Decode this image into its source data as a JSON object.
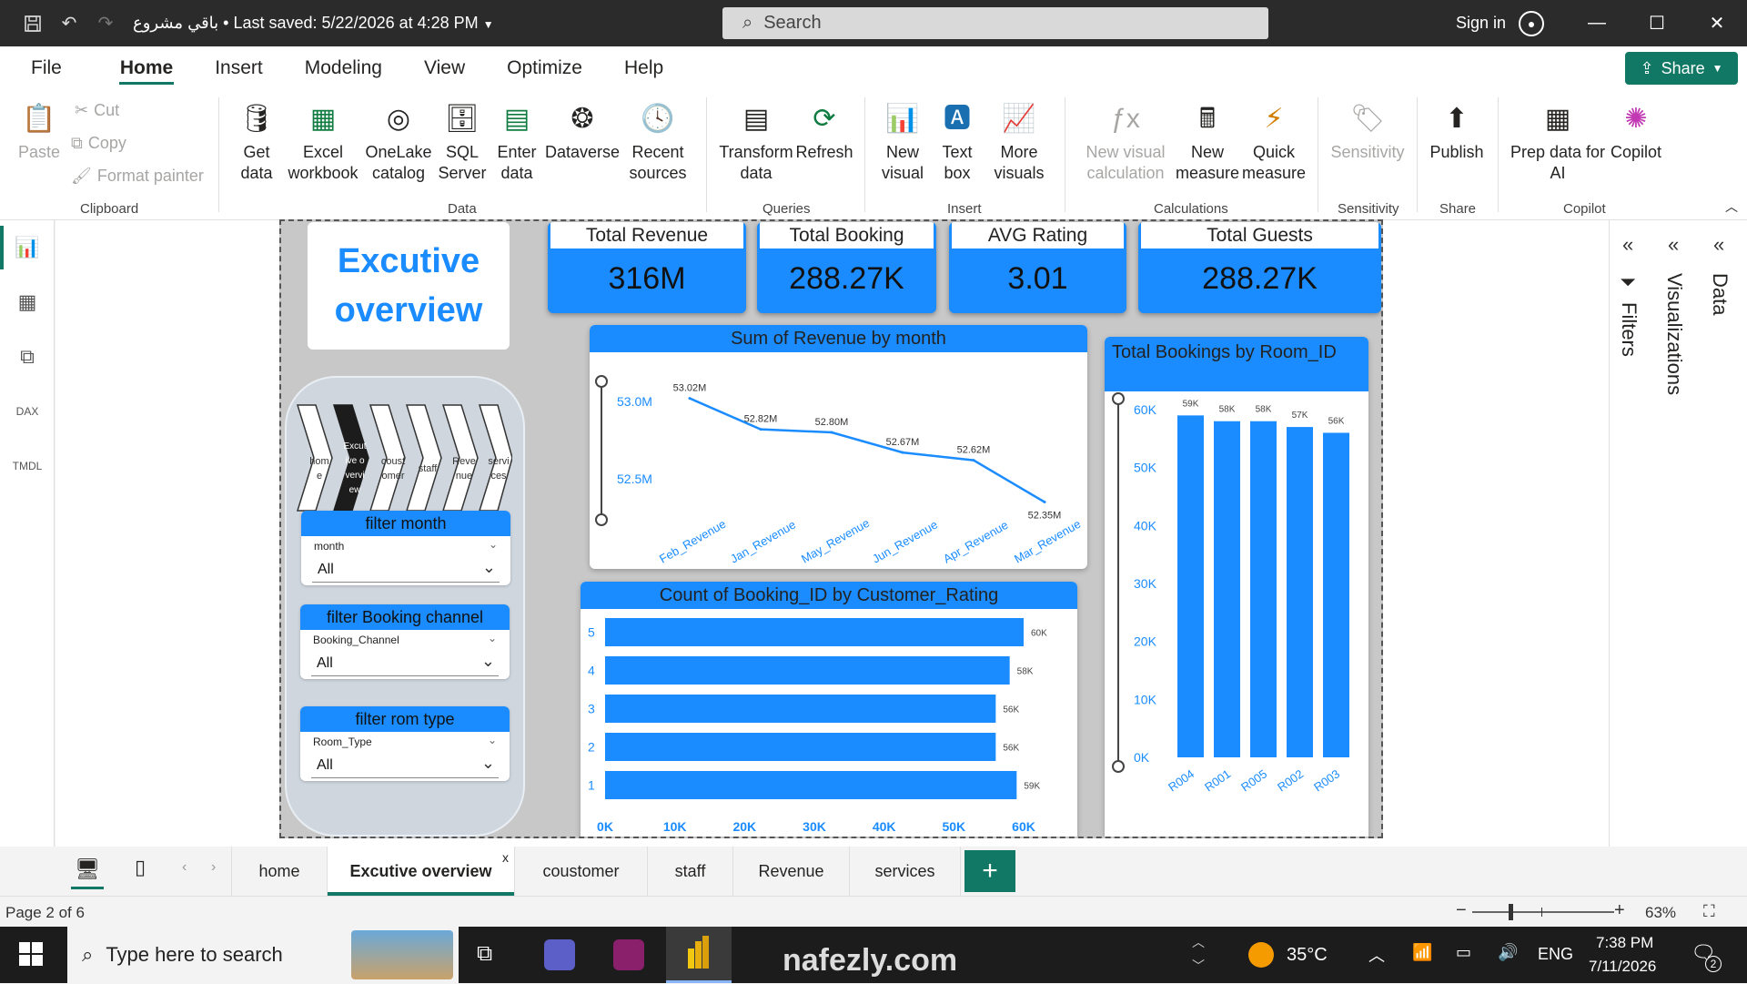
{
  "titlebar": {
    "doc_title": "باقي مشروع • Last saved: 5/22/2026 at 4:28 PM",
    "search_placeholder": "Search",
    "signin": "Sign in"
  },
  "ribbon_tabs": [
    "File",
    "Home",
    "Insert",
    "Modeling",
    "View",
    "Optimize",
    "Help"
  ],
  "share_label": "Share",
  "ribbon": {
    "clipboard": {
      "paste": "Paste",
      "cut": "Cut",
      "copy": "Copy",
      "format_painter": "Format painter",
      "label": "Clipboard"
    },
    "data": {
      "get_data": "Get data",
      "excel": "Excel workbook",
      "onelake": "OneLake catalog",
      "sql": "SQL Server",
      "enter": "Enter data",
      "dataverse": "Dataverse",
      "recent": "Recent sources",
      "label": "Data"
    },
    "queries": {
      "transform": "Transform data",
      "refresh": "Refresh",
      "label": "Queries"
    },
    "insert": {
      "new_visual": "New visual",
      "text_box": "Text box",
      "more_visuals": "More visuals",
      "label": "Insert"
    },
    "calculations": {
      "new_visual_calc": "New visual calculation",
      "new_measure": "New measure",
      "quick_measure": "Quick measure",
      "label": "Calculations"
    },
    "sensitivity": {
      "btn": "Sensitivity",
      "label": "Sensitivity"
    },
    "share": {
      "publish": "Publish",
      "label": "Share"
    },
    "copilot": {
      "prep": "Prep data for AI",
      "copilot": "Copilot",
      "label": "Copilot"
    }
  },
  "report": {
    "title": "Excutive overview",
    "kpis": [
      {
        "label": "Total Revenue",
        "value": "316M"
      },
      {
        "label": "Total Booking",
        "value": "288.27K"
      },
      {
        "label": "AVG Rating",
        "value": "3.01"
      },
      {
        "label": "Total Guests",
        "value": "288.27K"
      }
    ],
    "nav_chevrons": [
      "home",
      "Excutive overview",
      "coustomer",
      "staff",
      "Revenue",
      "services"
    ],
    "slicers": [
      {
        "title": "filter month",
        "field": "month",
        "selected": "All"
      },
      {
        "title": "filter Booking channel",
        "field": "Booking_Channel",
        "selected": "All"
      },
      {
        "title": "filter rom type",
        "field": "Room_Type",
        "selected": "All"
      }
    ]
  },
  "chart_data": [
    {
      "type": "line",
      "title": "Sum of Revenue by month",
      "categories": [
        "Feb_Revenue",
        "Jan_Revenue",
        "May_Revenue",
        "Jun_Revenue",
        "Apr_Revenue",
        "Mar_Revenue"
      ],
      "values": [
        53.02,
        52.82,
        52.8,
        52.67,
        52.62,
        52.35
      ],
      "data_labels": [
        "53.02M",
        "52.82M",
        "52.80M",
        "52.67M",
        "52.62M",
        "52.35M"
      ],
      "yticks": [
        "53.0M",
        "52.5M"
      ],
      "ylim": [
        52.2,
        53.2
      ],
      "color": "#1a8cff"
    },
    {
      "type": "bar",
      "orientation": "horizontal",
      "title": "Count of Booking_ID by Customer_Rating",
      "categories": [
        "5",
        "4",
        "3",
        "2",
        "1"
      ],
      "values": [
        60,
        58,
        56,
        56,
        59
      ],
      "data_labels": [
        "60K",
        "58K",
        "56K",
        "56K",
        "59K"
      ],
      "xticks": [
        "0K",
        "10K",
        "20K",
        "30K",
        "40K",
        "50K",
        "60K"
      ],
      "xlim": [
        0,
        60
      ],
      "color": "#1a8cff"
    },
    {
      "type": "bar",
      "title": "Total Bookings by Room_ID",
      "categories": [
        "R004",
        "R001",
        "R005",
        "R002",
        "R003"
      ],
      "values": [
        59,
        58,
        58,
        57,
        56
      ],
      "data_labels": [
        "59K",
        "58K",
        "58K",
        "57K",
        "56K"
      ],
      "yticks": [
        "60K",
        "50K",
        "40K",
        "30K",
        "20K",
        "10K",
        "0K"
      ],
      "ylim": [
        0,
        60
      ],
      "color": "#1a8cff"
    }
  ],
  "panes": {
    "filters": "Filters",
    "visualizations": "Visualizations",
    "data": "Data"
  },
  "page_tabs": [
    "home",
    "Excutive overview",
    "coustomer",
    "staff",
    "Revenue",
    "services"
  ],
  "statusbar": {
    "page": "Page 2 of 6",
    "zoom": "63%"
  },
  "taskbar": {
    "search": "Type here to search",
    "weather": "35°C",
    "lang": "ENG",
    "time": "7:38 PM",
    "date": "7/11/2026",
    "notif": "2",
    "watermark": "nafezly.com"
  }
}
